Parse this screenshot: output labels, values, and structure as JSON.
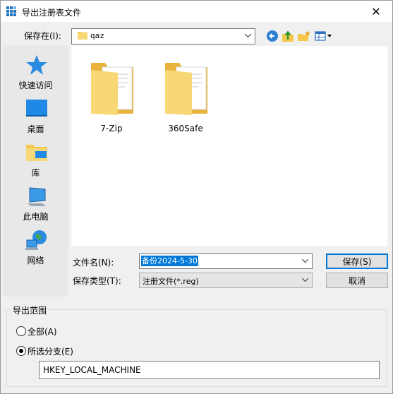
{
  "window": {
    "title": "导出注册表文件",
    "close_glyph": "✕"
  },
  "location": {
    "label": "保存在(I):",
    "current": "qaz"
  },
  "places": [
    {
      "label": "快速访问",
      "icon": "star-icon"
    },
    {
      "label": "桌面",
      "icon": "desktop-icon"
    },
    {
      "label": "库",
      "icon": "library-icon"
    },
    {
      "label": "此电脑",
      "icon": "computer-icon"
    },
    {
      "label": "网络",
      "icon": "network-icon"
    }
  ],
  "files": [
    {
      "name": "7-Zip",
      "icon": "folder-icon"
    },
    {
      "name": "360Safe",
      "icon": "folder-icon"
    }
  ],
  "filename": {
    "label": "文件名(N):",
    "value": "备份2024-5-30"
  },
  "filetype": {
    "label": "保存类型(T):",
    "value": "注册文件(*.reg)"
  },
  "buttons": {
    "save": "保存(S)",
    "cancel": "取消"
  },
  "export_range": {
    "title": "导出范围",
    "all_label": "全部(A)",
    "selected_label": "所选分支(E)",
    "selected": "selected_branch",
    "branch_value": "HKEY_LOCAL_MACHINE"
  },
  "colors": {
    "accent": "#0078d7",
    "folder": "#f5c84c"
  }
}
